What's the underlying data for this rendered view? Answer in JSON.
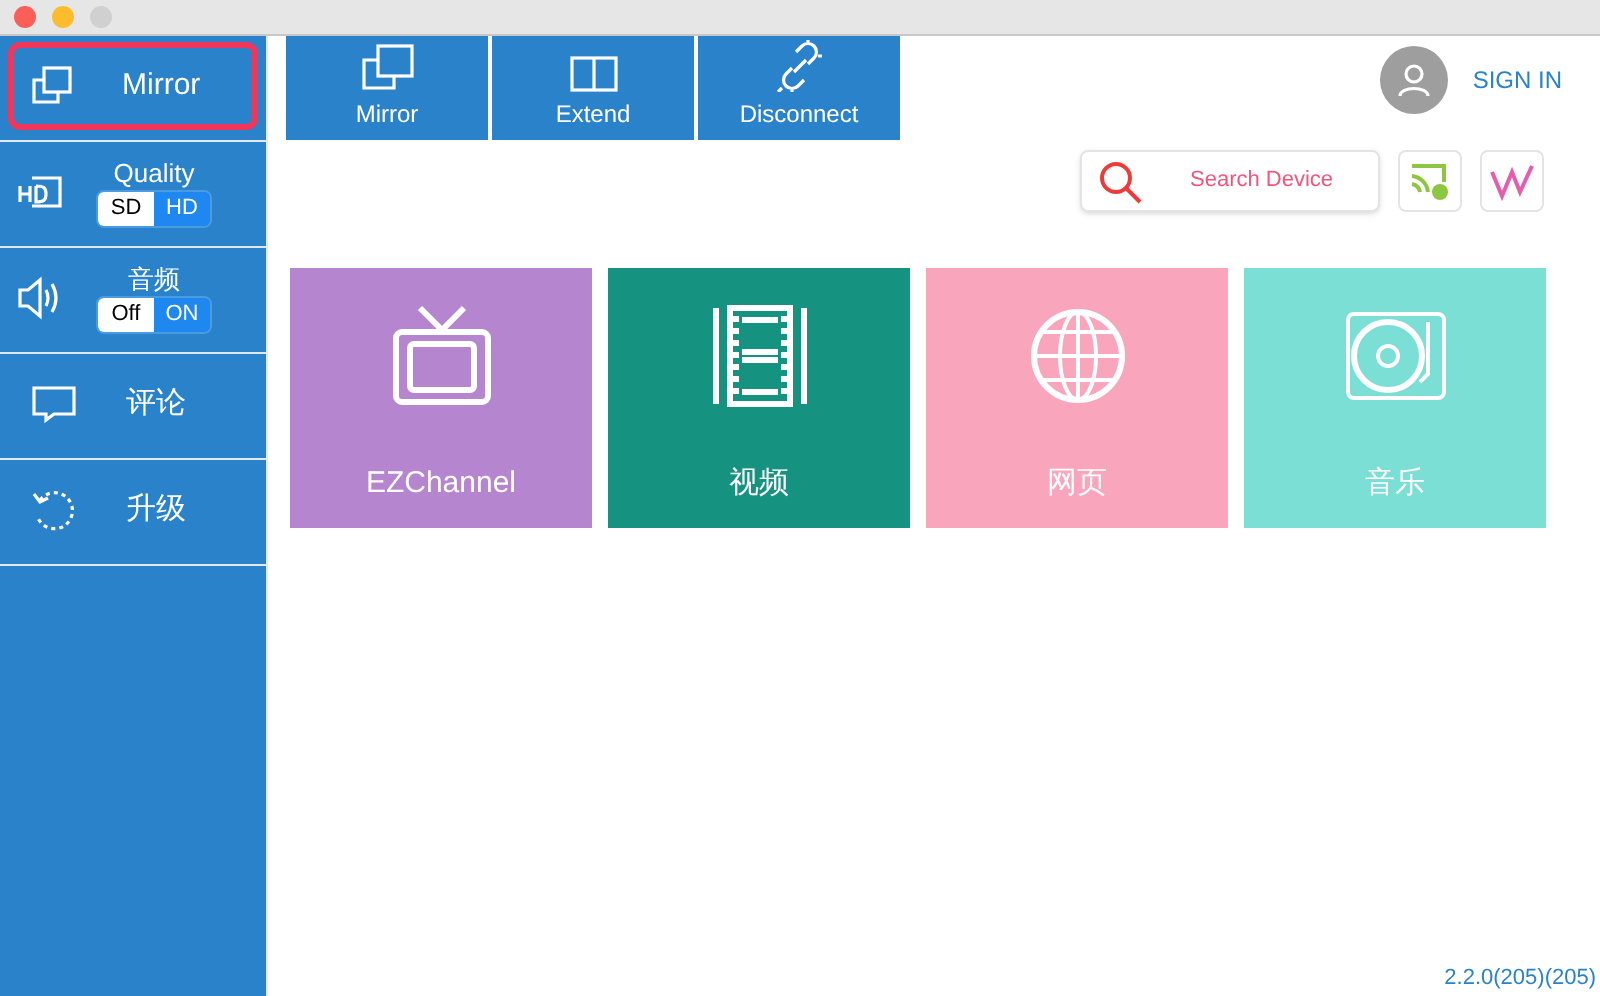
{
  "sidebar": {
    "items": [
      {
        "kind": "mirror",
        "label": "Mirror",
        "selected": true
      },
      {
        "kind": "quality",
        "label": "Quality",
        "options": [
          {
            "label": "SD",
            "selected": true
          },
          {
            "label": "HD",
            "selected": false
          }
        ]
      },
      {
        "kind": "audio",
        "label": "音频",
        "options": [
          {
            "label": "Off",
            "selected": true
          },
          {
            "label": "ON",
            "selected": false
          }
        ]
      },
      {
        "kind": "comment",
        "label": "评论"
      },
      {
        "kind": "upgrade",
        "label": "升级"
      }
    ]
  },
  "toolbar": [
    {
      "kind": "mirror",
      "label": "Mirror"
    },
    {
      "kind": "extend",
      "label": "Extend"
    },
    {
      "kind": "disconnect",
      "label": "Disconnect"
    }
  ],
  "account": {
    "label": "SIGN IN"
  },
  "search": {
    "label": "Search Device"
  },
  "tiles": [
    {
      "kind": "tv",
      "label": "EZChannel",
      "color": "#b585cf"
    },
    {
      "kind": "film",
      "label": "视频",
      "color": "#169280"
    },
    {
      "kind": "globe",
      "label": "网页",
      "color": "#f9a6bd"
    },
    {
      "kind": "turntable",
      "label": "音乐",
      "color": "#7bdfd5"
    }
  ],
  "version": "2.2.0(205)(205)"
}
